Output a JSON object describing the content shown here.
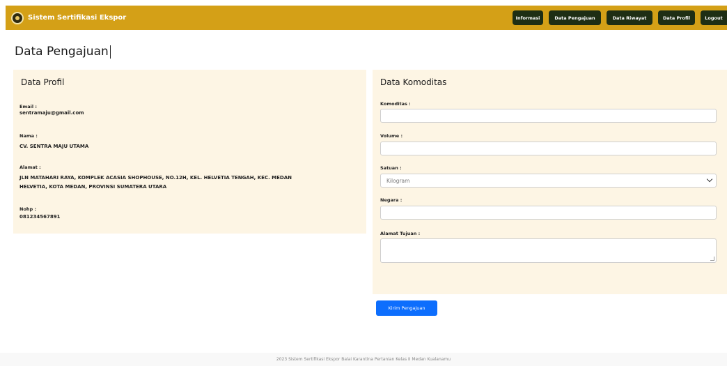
{
  "app": {
    "title": "Sistem Sertifikasi Ekspor"
  },
  "nav": {
    "items": [
      "Informasi",
      "Data Pengajuan",
      "Data Riwayat",
      "Data Profil",
      "Logout"
    ]
  },
  "page": {
    "title": "Data Pengajuan"
  },
  "profile": {
    "title": "Data Profil",
    "email_label": "Email :",
    "email_value": "sentramaju@gmail.com",
    "nama_label": "Nama :",
    "nama_value": "CV. SENTRA MAJU UTAMA",
    "alamat_label": "Alamat :",
    "alamat_line1": "JLN MATAHARI RAYA, KOMPLEK ACASIA SHOPHOUSE, NO.12H, KEL. HELVETIA TENGAH, KEC. MEDAN",
    "alamat_line2": "HELVETIA, KOTA MEDAN, PROVINSI SUMATERA UTARA",
    "nohp_label": "Nohp :",
    "nohp_value": "081234567891"
  },
  "komoditas": {
    "title": "Data Komoditas",
    "komoditas_label": "Komoditas :",
    "komoditas_value": "",
    "volume_label": "Volume :",
    "volume_value": "",
    "satuan_label": "Satuan :",
    "satuan_selected": "Kilogram",
    "negara_label": "Negara :",
    "negara_value": "",
    "alamat_tujuan_label": "Alamat Tujuan :",
    "alamat_tujuan_value": ""
  },
  "submit": {
    "label": "Kirim Pengajuan"
  },
  "footer": {
    "text": "2023 Sistem Sertifikasi Ekspor Balai Karantina Pertanian Kelas II Medan Kualanamu"
  },
  "colors": {
    "navbar": "#d4a017",
    "nav_button": "#1e2e14",
    "panel_bg": "#fdf5e4",
    "primary": "#0d6efd"
  },
  "icons": {
    "brand": "logo-icon",
    "select_arrow": "chevron-down-icon"
  }
}
